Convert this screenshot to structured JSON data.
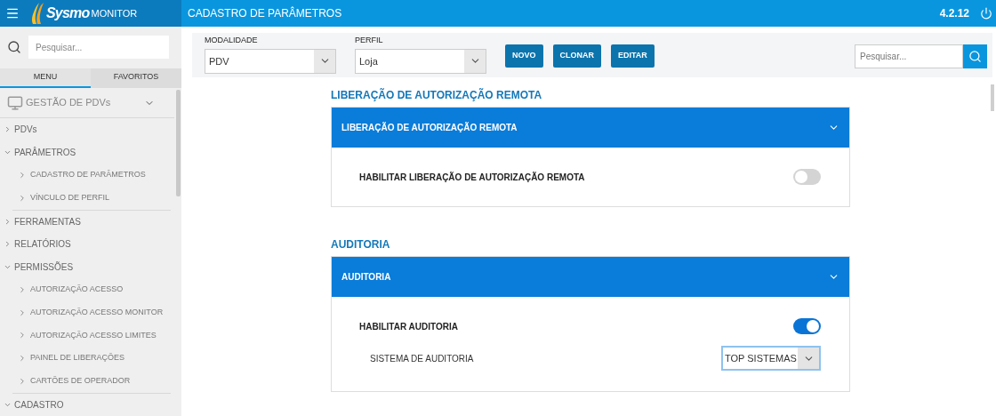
{
  "app": {
    "logo_text": "Sysmo",
    "logo_subtext": "MONITOR",
    "title": "CADASTRO DE PARÂMETROS",
    "version": "4.2.12"
  },
  "sidebar": {
    "search": {
      "placeholder": "Pesquisar..."
    },
    "tabs": [
      {
        "label": "MENU",
        "selected": true
      },
      {
        "label": "FAVORITOS",
        "selected": false
      }
    ],
    "group": {
      "label": "GESTÃO DE PDVs",
      "expanded": true
    },
    "items": [
      {
        "label": "PDVs",
        "expanded": false
      },
      {
        "label": "PARÂMETROS",
        "expanded": true,
        "children": [
          {
            "label": "CADASTRO DE PARÂMETROS"
          },
          {
            "label": "VÍNCULO DE PERFIL"
          }
        ]
      },
      {
        "label": "FERRAMENTAS",
        "expanded": false
      },
      {
        "label": "RELATÓRIOS",
        "expanded": false
      },
      {
        "label": "PERMISSÕES",
        "expanded": true,
        "children": [
          {
            "label": "AUTORIZAÇÃO ACESSO"
          },
          {
            "label": "AUTORIZAÇÃO ACESSO MONITOR"
          },
          {
            "label": "AUTORIZAÇÃO ACESSO LIMITES"
          },
          {
            "label": "PAINEL DE LIBERAÇÕES"
          },
          {
            "label": "CARTÕES DE OPERADOR"
          }
        ]
      },
      {
        "label": "CADASTRO",
        "expanded": true
      }
    ]
  },
  "toolbar": {
    "fields": [
      {
        "label": "MODALIDADE",
        "value": "PDV"
      },
      {
        "label": "PERFIL",
        "value": "Loja"
      }
    ],
    "buttons": [
      "NOVO",
      "CLONAR",
      "EDITAR"
    ],
    "search": {
      "placeholder": "Pesquisar..."
    }
  },
  "sections": [
    {
      "title": "LIBERAÇÃO DE AUTORIZAÇÃO REMOTA",
      "panel_title": "LIBERAÇÃO DE AUTORIZAÇÃO REMOTA",
      "expanded": true,
      "rows": [
        {
          "kind": "toggle",
          "label": "HABILITAR LIBERAÇÃO DE AUTORIZAÇÃO REMOTA",
          "on": false
        }
      ]
    },
    {
      "title": "AUDITORIA",
      "panel_title": "AUDITORIA",
      "expanded": true,
      "rows": [
        {
          "kind": "toggle",
          "label": "HABILITAR AUDITORIA",
          "on": true
        },
        {
          "kind": "select",
          "label": "SISTEMA DE AUDITORIA",
          "value": "TOP SISTEMAS"
        }
      ]
    }
  ]
}
